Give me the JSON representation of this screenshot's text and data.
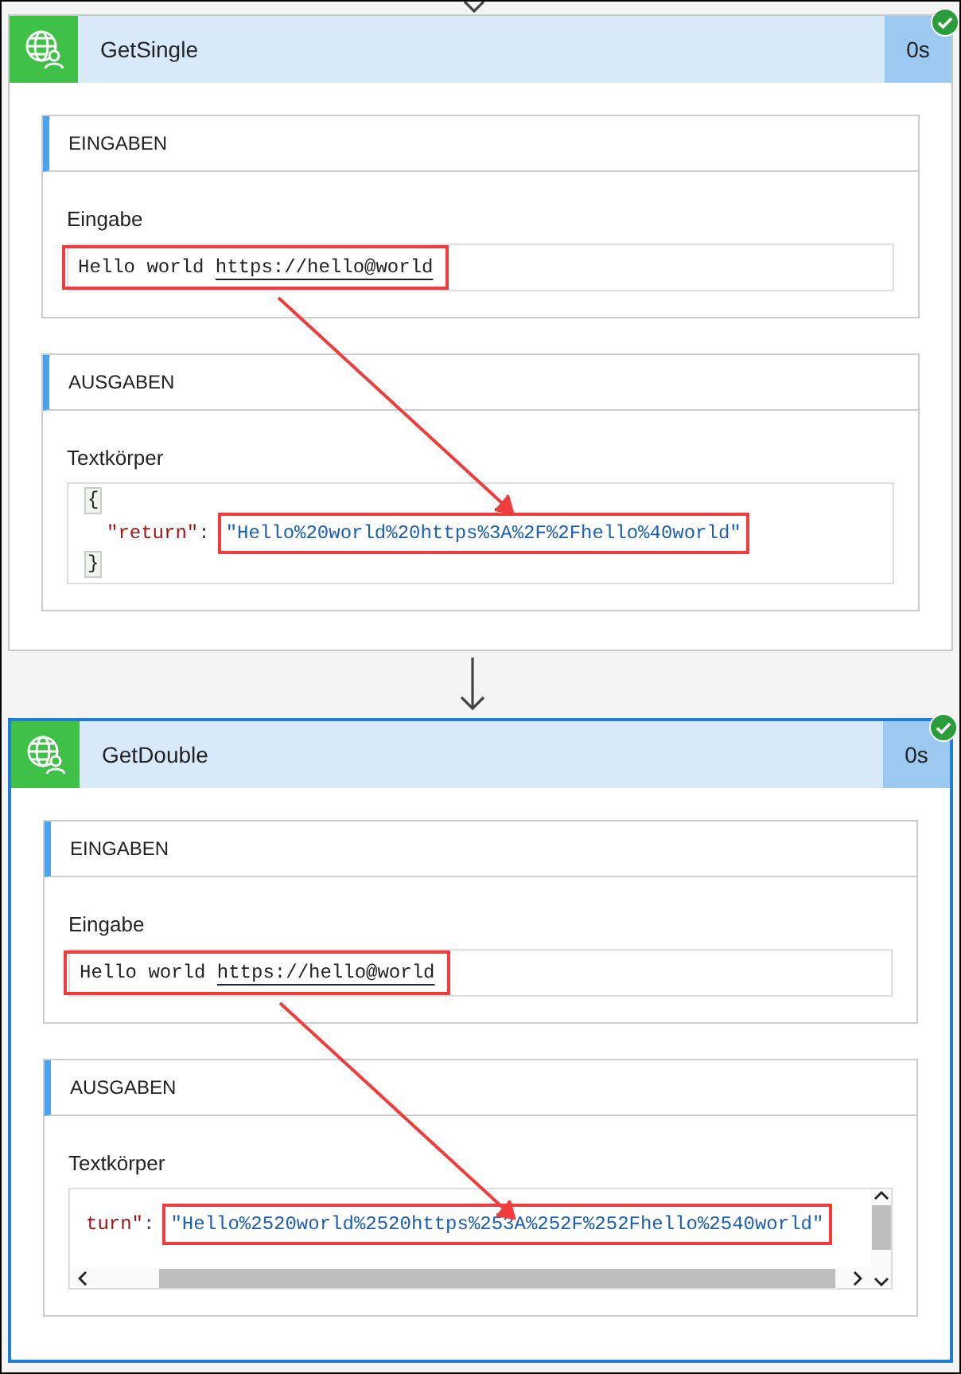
{
  "actions": [
    {
      "title": "GetSingle",
      "duration": "0s",
      "succeeded": true,
      "selected": false,
      "inputs": {
        "heading": "EINGABEN",
        "label": "Eingabe",
        "text": "Hello world",
        "link": "https://hello@world",
        "highlighted": true
      },
      "outputs": {
        "heading": "AUSGABEN",
        "label": "Textkörper",
        "open": "{",
        "key": "\"return\"",
        "separator": ":",
        "value": "\"Hello%20world%20https%3A%2F%2Fhello%40world\"",
        "close": "}",
        "highlighted": true,
        "scrollbars": false
      }
    },
    {
      "title": "GetDouble",
      "duration": "0s",
      "succeeded": true,
      "selected": true,
      "inputs": {
        "heading": "EINGABEN",
        "label": "Eingabe",
        "text": "Hello world",
        "link": "https://hello@world",
        "highlighted": true
      },
      "outputs": {
        "heading": "AUSGABEN",
        "label": "Textkörper",
        "key": "turn\"",
        "separator": ":",
        "value": "\"Hello%2520world%2520https%253A%252F%252Fhello%2540world\"",
        "highlighted": true,
        "scrollbars": true
      }
    }
  ]
}
